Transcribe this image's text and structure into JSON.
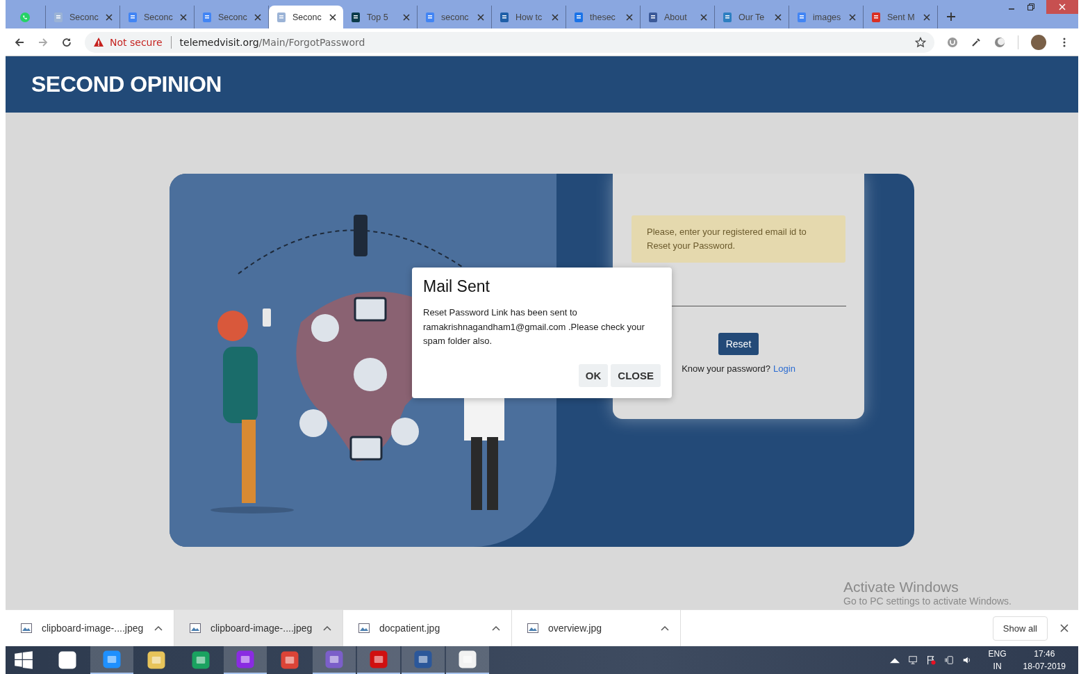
{
  "browser": {
    "tabs": [
      {
        "selected": false
      },
      {
        "title": "Seconc",
        "selected": false
      },
      {
        "title": "Seconc",
        "selected": false
      },
      {
        "title": "Seconc",
        "selected": false
      },
      {
        "title": "Seconc",
        "selected": true
      },
      {
        "title": "Top 5",
        "selected": false
      },
      {
        "title": "seconc",
        "selected": false
      },
      {
        "title": "How tc",
        "selected": false
      },
      {
        "title": "thesec",
        "selected": false
      },
      {
        "title": "About",
        "selected": false
      },
      {
        "title": "Our Te",
        "selected": false
      },
      {
        "title": "images",
        "selected": false
      },
      {
        "title": "Sent M",
        "selected": false
      }
    ],
    "address": {
      "security": "Not secure",
      "host": "telemedvisit.org",
      "path": "/Main/ForgotPassword"
    }
  },
  "site": {
    "title": "SECOND OPINION"
  },
  "form": {
    "notice": "Please, enter your registered email id to Reset your Password.",
    "reset_button": "Reset",
    "login_prompt": "Know your password?",
    "login_link": "Login"
  },
  "dialog": {
    "title": "Mail Sent",
    "message": "Reset Password Link has been sent to ramakrishnagandham1@gmail.com .Please check your spam folder also.",
    "buttons": [
      "OK",
      "CLOSE"
    ]
  },
  "watermark": {
    "title": "Activate Windows",
    "subtitle": "Go to PC settings to activate Windows."
  },
  "downloads": {
    "items": [
      {
        "name": "clipboard-image-....jpeg",
        "hovered": false
      },
      {
        "name": "clipboard-image-....jpeg",
        "hovered": true
      },
      {
        "name": "docpatient.jpg",
        "hovered": false
      },
      {
        "name": "overview.jpg",
        "hovered": false
      }
    ],
    "show_all": "Show all"
  },
  "taskbar": {
    "apps": [
      {
        "running": false
      },
      {
        "running": true
      },
      {
        "running": false
      },
      {
        "running": false
      },
      {
        "running": true
      },
      {
        "running": false
      },
      {
        "running": true
      },
      {
        "running": true
      },
      {
        "running": true
      },
      {
        "running": true
      }
    ],
    "language": "ENG",
    "region": "IN",
    "time": "17:46",
    "date": "18-07-2019"
  }
}
